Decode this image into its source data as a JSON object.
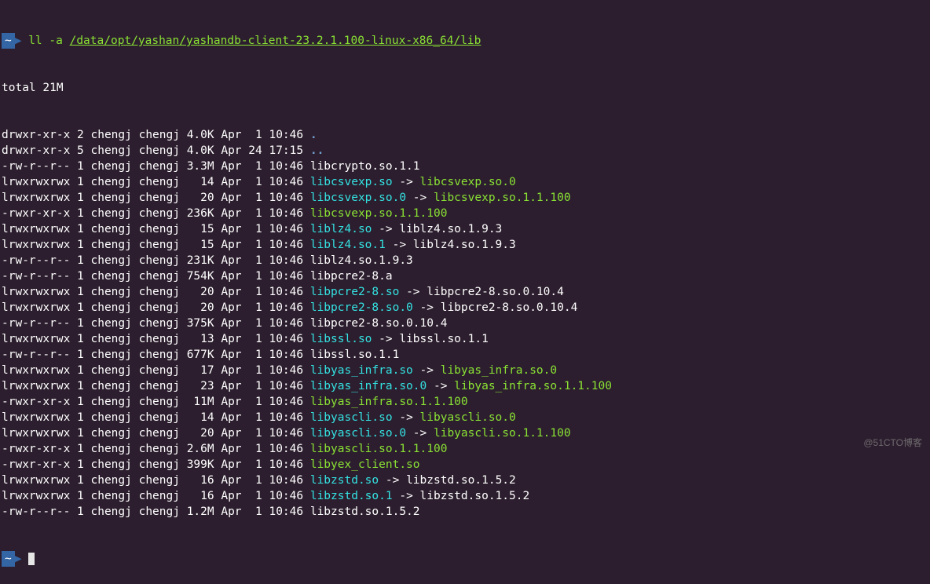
{
  "prompt": {
    "symbol": "~",
    "command": "ll -a",
    "path": "/data/opt/yashan/yashandb-client-23.2.1.100-linux-x86_64/lib"
  },
  "total_line": "total 21M",
  "entries": [
    {
      "perm": "drwxr-xr-x",
      "links": "2",
      "user": "chengj",
      "group": "chengj",
      "size": "4.0K",
      "month": "Apr",
      "day": " 1",
      "time": "10:46",
      "name": ".",
      "type": "dir"
    },
    {
      "perm": "drwxr-xr-x",
      "links": "5",
      "user": "chengj",
      "group": "chengj",
      "size": "4.0K",
      "month": "Apr",
      "day": "24",
      "time": "17:15",
      "name": "..",
      "type": "dir"
    },
    {
      "perm": "-rw-r--r--",
      "links": "1",
      "user": "chengj",
      "group": "chengj",
      "size": "3.3M",
      "month": "Apr",
      "day": " 1",
      "time": "10:46",
      "name": "libcrypto.so.1.1",
      "type": "file"
    },
    {
      "perm": "lrwxrwxrwx",
      "links": "1",
      "user": "chengj",
      "group": "chengj",
      "size": "  14",
      "month": "Apr",
      "day": " 1",
      "time": "10:46",
      "name": "libcsvexp.so",
      "type": "symlink",
      "target": "libcsvexp.so.0",
      "target_type": "exec"
    },
    {
      "perm": "lrwxrwxrwx",
      "links": "1",
      "user": "chengj",
      "group": "chengj",
      "size": "  20",
      "month": "Apr",
      "day": " 1",
      "time": "10:46",
      "name": "libcsvexp.so.0",
      "type": "symlink",
      "target": "libcsvexp.so.1.1.100",
      "target_type": "exec"
    },
    {
      "perm": "-rwxr-xr-x",
      "links": "1",
      "user": "chengj",
      "group": "chengj",
      "size": "236K",
      "month": "Apr",
      "day": " 1",
      "time": "10:46",
      "name": "libcsvexp.so.1.1.100",
      "type": "exec"
    },
    {
      "perm": "lrwxrwxrwx",
      "links": "1",
      "user": "chengj",
      "group": "chengj",
      "size": "  15",
      "month": "Apr",
      "day": " 1",
      "time": "10:46",
      "name": "liblz4.so",
      "type": "symlink",
      "target": "liblz4.so.1.9.3",
      "target_type": "file"
    },
    {
      "perm": "lrwxrwxrwx",
      "links": "1",
      "user": "chengj",
      "group": "chengj",
      "size": "  15",
      "month": "Apr",
      "day": " 1",
      "time": "10:46",
      "name": "liblz4.so.1",
      "type": "symlink",
      "target": "liblz4.so.1.9.3",
      "target_type": "file"
    },
    {
      "perm": "-rw-r--r--",
      "links": "1",
      "user": "chengj",
      "group": "chengj",
      "size": "231K",
      "month": "Apr",
      "day": " 1",
      "time": "10:46",
      "name": "liblz4.so.1.9.3",
      "type": "file"
    },
    {
      "perm": "-rw-r--r--",
      "links": "1",
      "user": "chengj",
      "group": "chengj",
      "size": "754K",
      "month": "Apr",
      "day": " 1",
      "time": "10:46",
      "name": "libpcre2-8.a",
      "type": "file"
    },
    {
      "perm": "lrwxrwxrwx",
      "links": "1",
      "user": "chengj",
      "group": "chengj",
      "size": "  20",
      "month": "Apr",
      "day": " 1",
      "time": "10:46",
      "name": "libpcre2-8.so",
      "type": "symlink",
      "target": "libpcre2-8.so.0.10.4",
      "target_type": "file"
    },
    {
      "perm": "lrwxrwxrwx",
      "links": "1",
      "user": "chengj",
      "group": "chengj",
      "size": "  20",
      "month": "Apr",
      "day": " 1",
      "time": "10:46",
      "name": "libpcre2-8.so.0",
      "type": "symlink",
      "target": "libpcre2-8.so.0.10.4",
      "target_type": "file"
    },
    {
      "perm": "-rw-r--r--",
      "links": "1",
      "user": "chengj",
      "group": "chengj",
      "size": "375K",
      "month": "Apr",
      "day": " 1",
      "time": "10:46",
      "name": "libpcre2-8.so.0.10.4",
      "type": "file"
    },
    {
      "perm": "lrwxrwxrwx",
      "links": "1",
      "user": "chengj",
      "group": "chengj",
      "size": "  13",
      "month": "Apr",
      "day": " 1",
      "time": "10:46",
      "name": "libssl.so",
      "type": "symlink",
      "target": "libssl.so.1.1",
      "target_type": "file"
    },
    {
      "perm": "-rw-r--r--",
      "links": "1",
      "user": "chengj",
      "group": "chengj",
      "size": "677K",
      "month": "Apr",
      "day": " 1",
      "time": "10:46",
      "name": "libssl.so.1.1",
      "type": "file"
    },
    {
      "perm": "lrwxrwxrwx",
      "links": "1",
      "user": "chengj",
      "group": "chengj",
      "size": "  17",
      "month": "Apr",
      "day": " 1",
      "time": "10:46",
      "name": "libyas_infra.so",
      "type": "symlink",
      "target": "libyas_infra.so.0",
      "target_type": "exec"
    },
    {
      "perm": "lrwxrwxrwx",
      "links": "1",
      "user": "chengj",
      "group": "chengj",
      "size": "  23",
      "month": "Apr",
      "day": " 1",
      "time": "10:46",
      "name": "libyas_infra.so.0",
      "type": "symlink",
      "target": "libyas_infra.so.1.1.100",
      "target_type": "exec"
    },
    {
      "perm": "-rwxr-xr-x",
      "links": "1",
      "user": "chengj",
      "group": "chengj",
      "size": " 11M",
      "month": "Apr",
      "day": " 1",
      "time": "10:46",
      "name": "libyas_infra.so.1.1.100",
      "type": "exec"
    },
    {
      "perm": "lrwxrwxrwx",
      "links": "1",
      "user": "chengj",
      "group": "chengj",
      "size": "  14",
      "month": "Apr",
      "day": " 1",
      "time": "10:46",
      "name": "libyascli.so",
      "type": "symlink",
      "target": "libyascli.so.0",
      "target_type": "exec"
    },
    {
      "perm": "lrwxrwxrwx",
      "links": "1",
      "user": "chengj",
      "group": "chengj",
      "size": "  20",
      "month": "Apr",
      "day": " 1",
      "time": "10:46",
      "name": "libyascli.so.0",
      "type": "symlink",
      "target": "libyascli.so.1.1.100",
      "target_type": "exec"
    },
    {
      "perm": "-rwxr-xr-x",
      "links": "1",
      "user": "chengj",
      "group": "chengj",
      "size": "2.6M",
      "month": "Apr",
      "day": " 1",
      "time": "10:46",
      "name": "libyascli.so.1.1.100",
      "type": "exec"
    },
    {
      "perm": "-rwxr-xr-x",
      "links": "1",
      "user": "chengj",
      "group": "chengj",
      "size": "399K",
      "month": "Apr",
      "day": " 1",
      "time": "10:46",
      "name": "libyex_client.so",
      "type": "exec"
    },
    {
      "perm": "lrwxrwxrwx",
      "links": "1",
      "user": "chengj",
      "group": "chengj",
      "size": "  16",
      "month": "Apr",
      "day": " 1",
      "time": "10:46",
      "name": "libzstd.so",
      "type": "symlink",
      "target": "libzstd.so.1.5.2",
      "target_type": "file"
    },
    {
      "perm": "lrwxrwxrwx",
      "links": "1",
      "user": "chengj",
      "group": "chengj",
      "size": "  16",
      "month": "Apr",
      "day": " 1",
      "time": "10:46",
      "name": "libzstd.so.1",
      "type": "symlink",
      "target": "libzstd.so.1.5.2",
      "target_type": "file"
    },
    {
      "perm": "-rw-r--r--",
      "links": "1",
      "user": "chengj",
      "group": "chengj",
      "size": "1.2M",
      "month": "Apr",
      "day": " 1",
      "time": "10:46",
      "name": "libzstd.so.1.5.2",
      "type": "file"
    }
  ],
  "watermark": "@51CTO博客"
}
